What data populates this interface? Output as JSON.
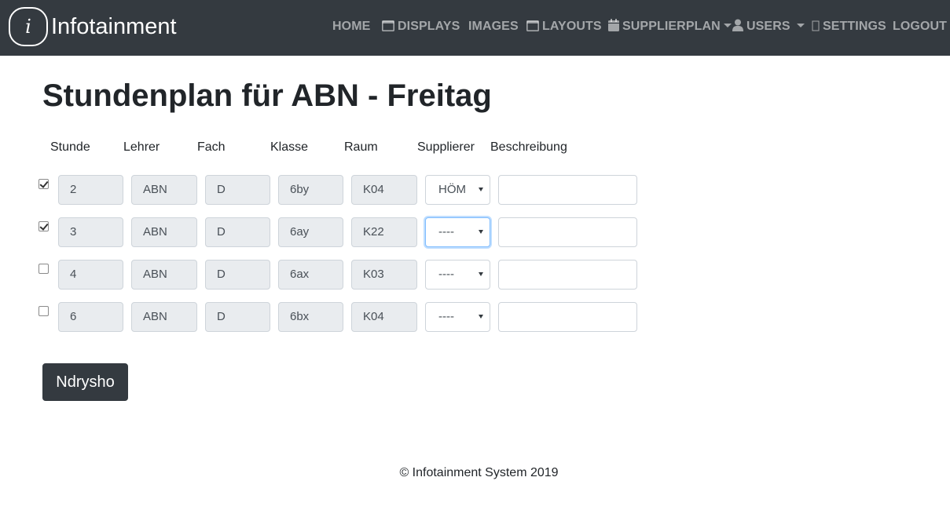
{
  "brand": {
    "logo_letter": "i",
    "name": "Infotainment"
  },
  "nav": {
    "home": "HOME",
    "displays": "DISPLAYS",
    "images": "IMAGES",
    "layouts": "LAYOUTS",
    "supplierplan": "SUPPLIERPLAN",
    "users": "USERS",
    "settings": "SETTINGS",
    "logout": "LOGOUT"
  },
  "page": {
    "title": "Stundenplan für ABN - Freitag"
  },
  "columns": {
    "stunde": "Stunde",
    "lehrer": "Lehrer",
    "fach": "Fach",
    "klasse": "Klasse",
    "raum": "Raum",
    "supplierer": "Supplierer",
    "beschreibung": "Beschreibung"
  },
  "rows": [
    {
      "checked": true,
      "stunde": "2",
      "lehrer": "ABN",
      "fach": "D",
      "klasse": "6by",
      "raum": "K04",
      "supplierer": "HÖM",
      "beschreibung": ""
    },
    {
      "checked": true,
      "stunde": "3",
      "lehrer": "ABN",
      "fach": "D",
      "klasse": "6ay",
      "raum": "K22",
      "supplierer": "----",
      "beschreibung": ""
    },
    {
      "checked": false,
      "stunde": "4",
      "lehrer": "ABN",
      "fach": "D",
      "klasse": "6ax",
      "raum": "K03",
      "supplierer": "----",
      "beschreibung": ""
    },
    {
      "checked": false,
      "stunde": "6",
      "lehrer": "ABN",
      "fach": "D",
      "klasse": "6bx",
      "raum": "K04",
      "supplierer": "----",
      "beschreibung": ""
    }
  ],
  "form": {
    "submit_label": "Ndrysho"
  },
  "footer": {
    "text": "© Infotainment System 2019"
  },
  "icons": {
    "displays": "window-icon",
    "layouts": "window-icon",
    "supplierplan": "calendar-icon",
    "users": "user-icon",
    "settings": "gear-icon"
  },
  "colors": {
    "navbar_bg": "#343a40",
    "button_bg": "#343a40",
    "readonly_bg": "#e9ecef",
    "focus_border": "#80bdff"
  }
}
